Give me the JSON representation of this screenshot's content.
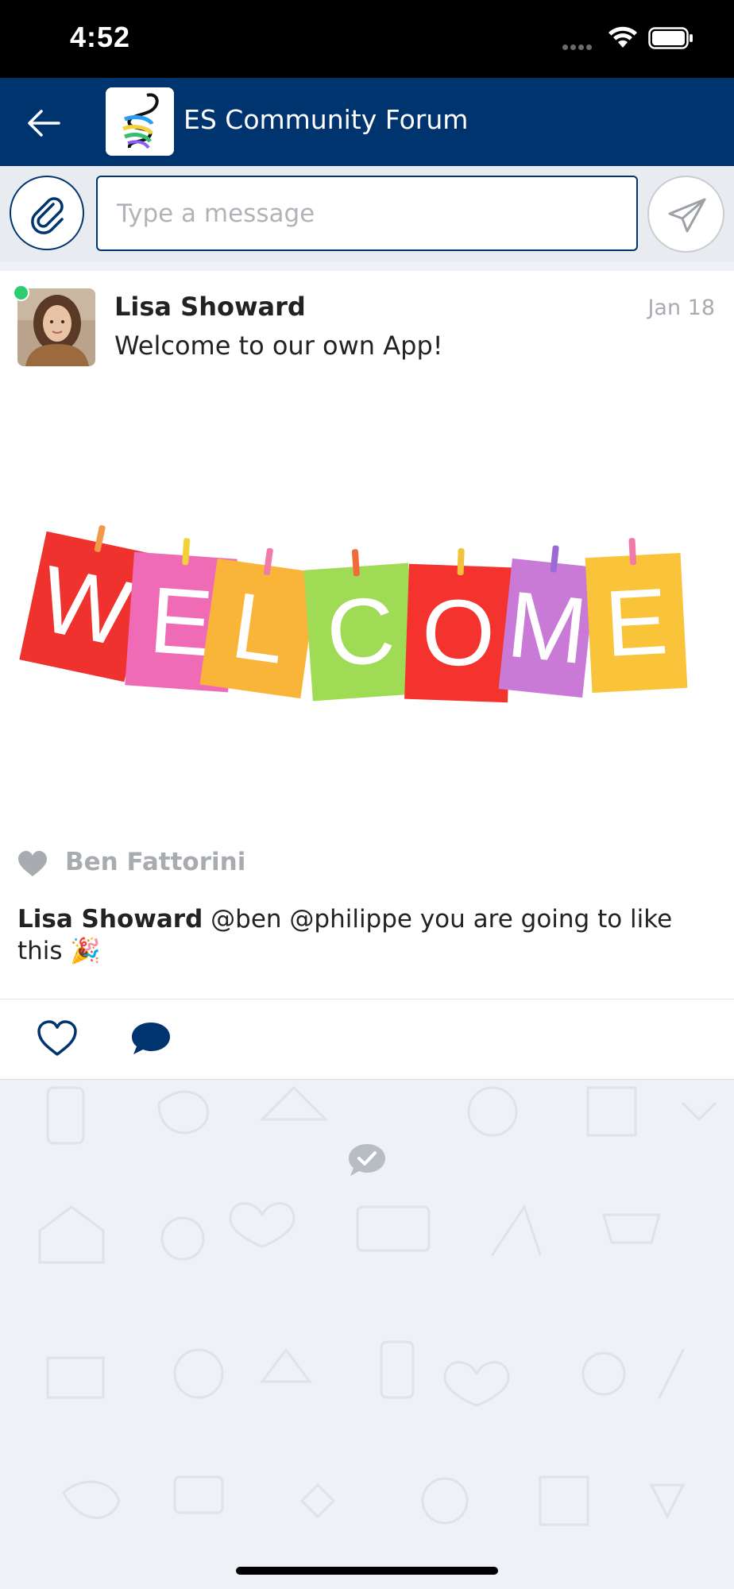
{
  "status_bar": {
    "time": "4:52"
  },
  "header": {
    "title": "ES Community Forum"
  },
  "composer": {
    "placeholder": "Type a message"
  },
  "post": {
    "author": "Lisa Showard",
    "date": "Jan 18",
    "text": "Welcome to our own App!",
    "image_letters": [
      "W",
      "E",
      "L",
      "C",
      "O",
      "M",
      "E"
    ],
    "liked_by": "Ben Fattorini",
    "comment": {
      "author": "Lisa Showard",
      "text": "@ben @philippe you are going to like this 🎉"
    }
  },
  "colors": {
    "header_bg": "#00346f",
    "accent": "#00346f",
    "online": "#2ecc71",
    "muted": "#a8acb1"
  },
  "icons": {
    "back": "arrow-left-icon",
    "attach": "paperclip-icon",
    "send": "paper-plane-icon",
    "like": "heart-outline-icon",
    "comment": "speech-bubble-icon",
    "read": "check-bubble-icon"
  }
}
